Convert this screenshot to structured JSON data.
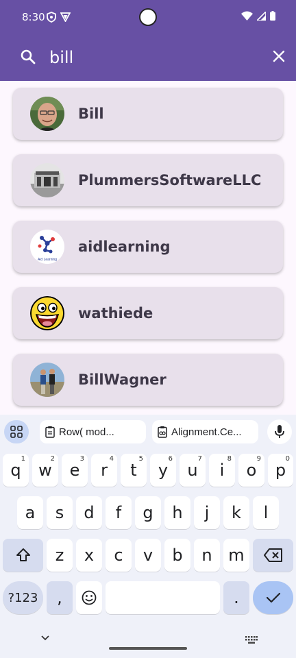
{
  "status": {
    "time": "8:30"
  },
  "search": {
    "query": "bill"
  },
  "results": [
    {
      "name": "Bill"
    },
    {
      "name": "PlummersSoftwareLLC"
    },
    {
      "name": "aidlearning"
    },
    {
      "name": "wathiede"
    },
    {
      "name": "BillWagner"
    }
  ],
  "keyboard": {
    "suggestions": [
      "Row(         mod...",
      "Alignment.Ce..."
    ],
    "row1": [
      {
        "k": "q",
        "h": "1"
      },
      {
        "k": "w",
        "h": "2"
      },
      {
        "k": "e",
        "h": "3"
      },
      {
        "k": "r",
        "h": "4"
      },
      {
        "k": "t",
        "h": "5"
      },
      {
        "k": "y",
        "h": "6"
      },
      {
        "k": "u",
        "h": "7"
      },
      {
        "k": "i",
        "h": "8"
      },
      {
        "k": "o",
        "h": "9"
      },
      {
        "k": "p",
        "h": "0"
      }
    ],
    "row2": [
      "a",
      "s",
      "d",
      "f",
      "g",
      "h",
      "j",
      "k",
      "l"
    ],
    "row3": [
      "z",
      "x",
      "c",
      "v",
      "b",
      "n",
      "m"
    ],
    "symbols_label": "?123",
    "comma": ",",
    "period": "."
  },
  "avatar_caption": "Aid Learning"
}
